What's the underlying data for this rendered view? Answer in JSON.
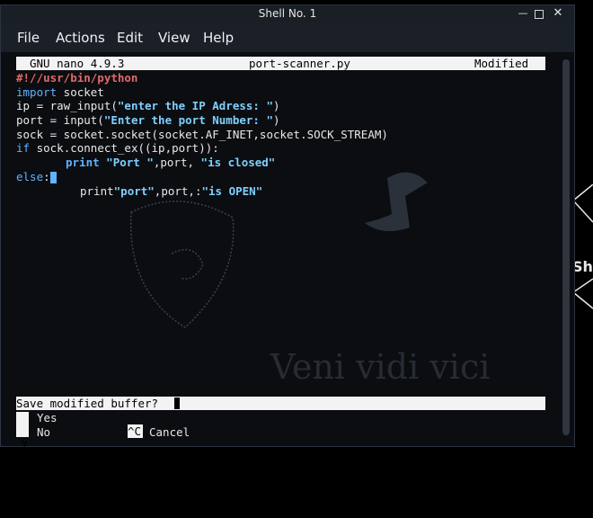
{
  "window": {
    "title": "Shell No. 1"
  },
  "menu": {
    "file": "File",
    "actions": "Actions",
    "edit": "Edit",
    "view": "View",
    "help": "Help"
  },
  "nano": {
    "version": "GNU nano 4.9.3",
    "filename": "port-scanner.py",
    "status": "Modified",
    "code": {
      "l1": "#!//usr/bin/python",
      "l2_kw": "import",
      "l2_rest": " socket",
      "l3_a": "ip = raw_input(",
      "l3_s": "\"enter the IP Adress: \"",
      "l3_b": ")",
      "l4_a": "port = input(",
      "l4_s": "\"Enter the port Number: \"",
      "l4_b": ")",
      "l5": "sock = socket.socket(socket.AF_INET,socket.SOCK_STREAM)",
      "l6_kw": "if",
      "l6_rest": " sock.connect_ex((ip,port)):",
      "l7_kw": "print",
      "l7_s1": "\"Port \"",
      "l7_m": ",port, ",
      "l7_s2": "\"is closed\"",
      "l8_kw": "else",
      "l8_rest": ":",
      "l9_a": "print",
      "l9_s1": "\"port\"",
      "l9_m": ",port,:",
      "l9_s2": "\"is OPEN\""
    },
    "prompt": "Save modified buffer?",
    "shortcuts": {
      "yes_key": "Y",
      "no_key": "N",
      "yes": "Yes",
      "no": "No",
      "cancel_key": "^C",
      "cancel": "Cancel"
    }
  },
  "desktop": {
    "right_edge_text": "She",
    "watermark": "Veni vidi vici"
  }
}
